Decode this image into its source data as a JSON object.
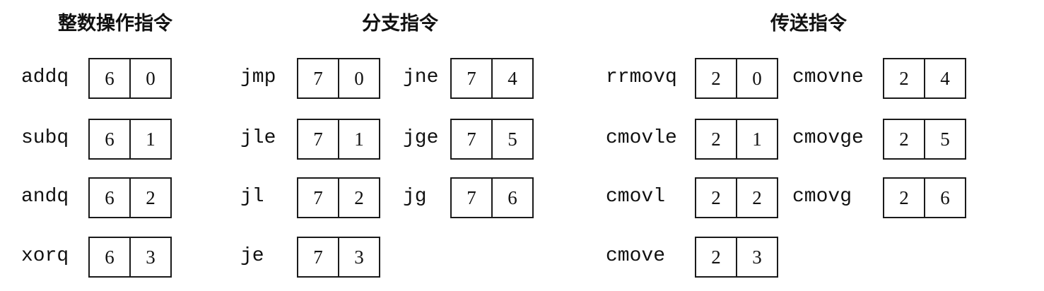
{
  "groups": [
    {
      "title": "整数操作指令",
      "instructions": [
        {
          "mnemonic": "addq",
          "icode": "6",
          "ifun": "0"
        },
        {
          "mnemonic": "subq",
          "icode": "6",
          "ifun": "1"
        },
        {
          "mnemonic": "andq",
          "icode": "6",
          "ifun": "2"
        },
        {
          "mnemonic": "xorq",
          "icode": "6",
          "ifun": "3"
        }
      ]
    },
    {
      "title": "分支指令",
      "instructions": [
        {
          "mnemonic": "jmp",
          "icode": "7",
          "ifun": "0"
        },
        {
          "mnemonic": "jle",
          "icode": "7",
          "ifun": "1"
        },
        {
          "mnemonic": "jl",
          "icode": "7",
          "ifun": "2"
        },
        {
          "mnemonic": "je",
          "icode": "7",
          "ifun": "3"
        },
        {
          "mnemonic": "jne",
          "icode": "7",
          "ifun": "4"
        },
        {
          "mnemonic": "jge",
          "icode": "7",
          "ifun": "5"
        },
        {
          "mnemonic": "jg",
          "icode": "7",
          "ifun": "6"
        }
      ]
    },
    {
      "title": "传送指令",
      "instructions": [
        {
          "mnemonic": "rrmovq",
          "icode": "2",
          "ifun": "0"
        },
        {
          "mnemonic": "cmovle",
          "icode": "2",
          "ifun": "1"
        },
        {
          "mnemonic": "cmovl",
          "icode": "2",
          "ifun": "2"
        },
        {
          "mnemonic": "cmove",
          "icode": "2",
          "ifun": "3"
        },
        {
          "mnemonic": "cmovne",
          "icode": "2",
          "ifun": "4"
        },
        {
          "mnemonic": "cmovge",
          "icode": "2",
          "ifun": "5"
        },
        {
          "mnemonic": "cmovg",
          "icode": "2",
          "ifun": "6"
        }
      ]
    }
  ]
}
